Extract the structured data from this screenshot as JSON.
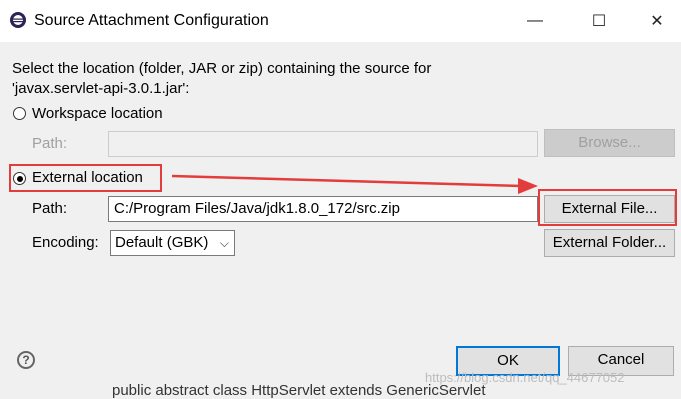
{
  "window": {
    "title": "Source Attachment Configuration",
    "minimize_glyph": "—",
    "maximize_glyph": "☐",
    "close_glyph": "✕"
  },
  "instructions": {
    "line1": "Select the location (folder, JAR or zip) containing the source for",
    "line2": "'javax.servlet-api-3.0.1.jar':"
  },
  "workspace": {
    "radio_label": "Workspace location",
    "selected": false,
    "path_label": "Path:",
    "path_value": "",
    "browse_label": "Browse..."
  },
  "external": {
    "radio_label": "External location",
    "selected": true,
    "path_label": "Path:",
    "path_value": "C:/Program Files/Java/jdk1.8.0_172/src.zip",
    "external_file_label": "External File...",
    "external_folder_label": "External Folder...",
    "encoding_label": "Encoding:",
    "encoding_value": "Default (GBK)"
  },
  "footer": {
    "help_glyph": "?",
    "ok_label": "OK",
    "cancel_label": "Cancel"
  },
  "annotations": {
    "highlight_color": "#e23c3c",
    "arrow_color": "#e23c3c"
  },
  "watermark": "https://blog.csdn.net/qq_44677052",
  "background_code": "public abstract class HttpServlet extends GenericServlet"
}
